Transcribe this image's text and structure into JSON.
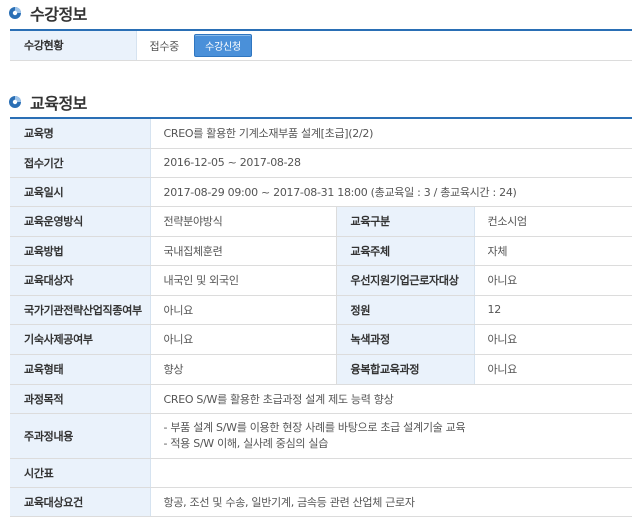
{
  "enroll_section": {
    "title": "수강정보",
    "status_label": "수강현황",
    "status_value": "접수중",
    "apply_button": "수강신청"
  },
  "edu_section": {
    "title": "교육정보",
    "course_name": {
      "label": "교육명",
      "value": "CREO를 활용한 기계소재부품 설계[초급](2/2)"
    },
    "reception_period": {
      "label": "접수기간",
      "value": "2016-12-05 ~ 2017-08-28"
    },
    "edu_dates": {
      "label": "교육일시",
      "value": "2017-08-29 09:00 ~ 2017-08-31 18:00 (총교육일 : 3 / 총교육시간 : 24)"
    },
    "pairs": [
      {
        "l1": "교육운영방식",
        "v1": "전략분야방식",
        "l2": "교육구분",
        "v2": "컨소시엄"
      },
      {
        "l1": "교육방법",
        "v1": "국내집체훈련",
        "l2": "교육주체",
        "v2": "자체"
      },
      {
        "l1": "교육대상자",
        "v1": "내국인 및 외국인",
        "l2": "우선지원기업근로자대상",
        "v2": "아니요"
      },
      {
        "l1": "국가기관전략산업직종여부",
        "v1": "아니요",
        "l2": "정원",
        "v2": "12"
      },
      {
        "l1": "기숙사제공여부",
        "v1": "아니요",
        "l2": "녹색과정",
        "v2": "아니요"
      },
      {
        "l1": "교육형태",
        "v1": "향상",
        "l2": "융복합교육과정",
        "v2": "아니요"
      }
    ],
    "course_goal": {
      "label": "과정목적",
      "value": "CREO S/W를 활용한 초급과정 설계 제도 능력 향상"
    },
    "main_content": {
      "label": "주과정내용",
      "lines": [
        "- 부품 설계 S/W를 이용한 현장 사례를 바탕으로 초급 설계기술 교육",
        "- 적용 S/W 이해, 실사례 중심의 실습"
      ]
    },
    "timetable": {
      "label": "시간표",
      "value": ""
    },
    "requirements": {
      "label": "교육대상요건",
      "value": "항공, 조선 및 수송, 일반기계, 금속등 관련 산업체 근로자"
    }
  }
}
